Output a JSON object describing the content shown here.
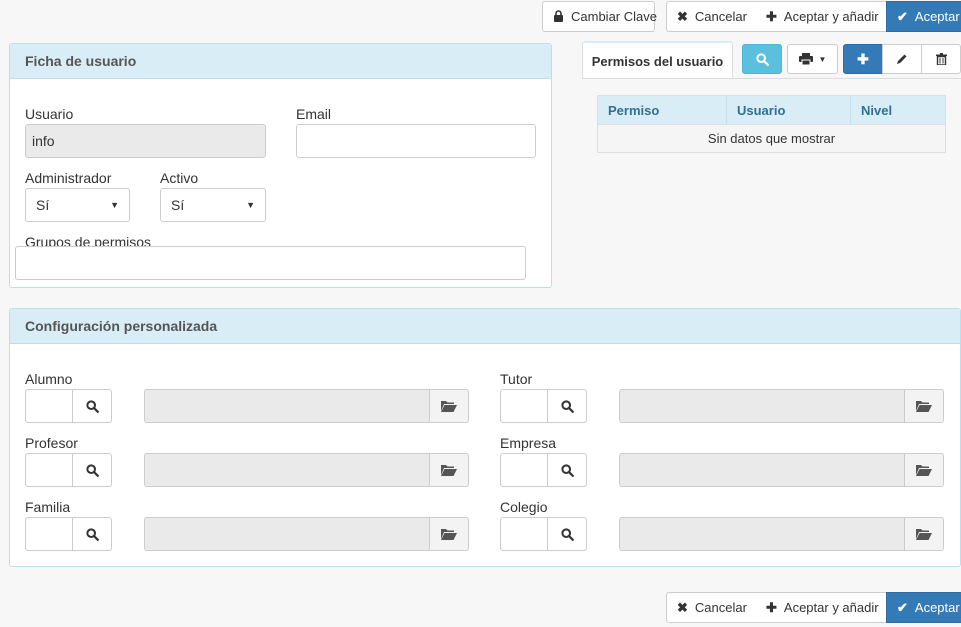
{
  "top_actions": {
    "change_password": "Cambiar Clave",
    "cancel": "Cancelar",
    "accept_add": "Aceptar y añadir",
    "accept": "Aceptar"
  },
  "user_panel": {
    "title": "Ficha de usuario",
    "usuario_label": "Usuario",
    "usuario_value": "info",
    "email_label": "Email",
    "email_value": "",
    "admin_label": "Administrador",
    "admin_value": "Sí",
    "active_label": "Activo",
    "active_value": "Sí",
    "groups_label": "Grupos de permisos",
    "groups_value": ""
  },
  "permissions": {
    "tab_label": "Permisos del usuario",
    "columns": [
      "Permiso",
      "Usuario",
      "Nivel"
    ],
    "empty_message": "Sin datos que mostrar"
  },
  "config_panel": {
    "title": "Configuración personalizada",
    "left_fields": [
      "Alumno",
      "Profesor",
      "Familia"
    ],
    "right_fields": [
      "Tutor",
      "Empresa",
      "Colegio"
    ]
  },
  "bottom_actions": {
    "cancel": "Cancelar",
    "accept_add": "Aceptar y añadir",
    "accept": "Aceptar"
  },
  "colors": {
    "panel_header": "#d9edf7",
    "primary": "#337ab7",
    "info_button": "#5bc0de",
    "disabled_field": "#eaeaea"
  }
}
